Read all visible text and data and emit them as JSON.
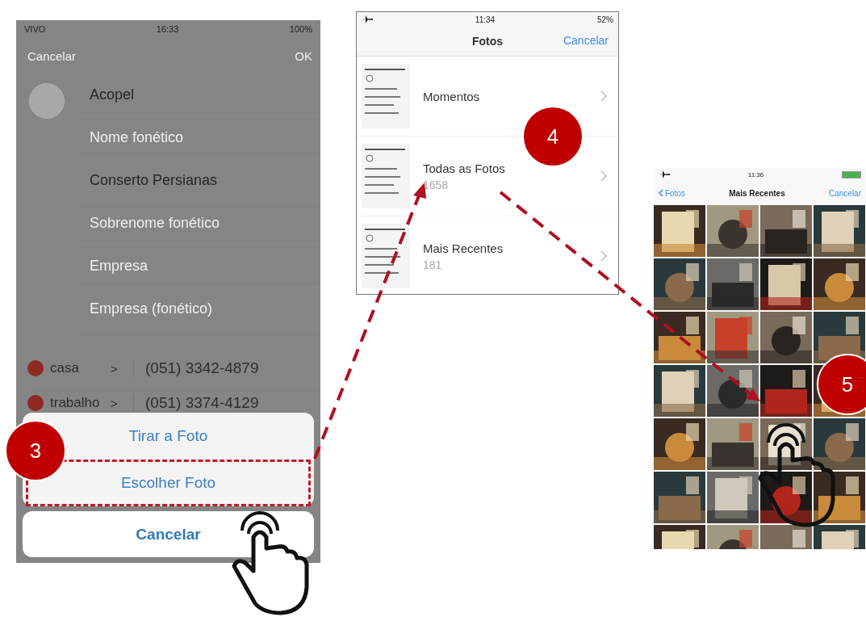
{
  "contact_screen": {
    "status_bar": {
      "carrier": "VIVO",
      "time": "16:33",
      "battery": "100%"
    },
    "nav": {
      "left": "Cancelar",
      "right": "OK"
    },
    "fields": [
      {
        "value": "Acopel"
      },
      {
        "placeholder": "Nome fonético"
      },
      {
        "value": "Conserto Persianas"
      },
      {
        "placeholder": "Sobrenome fonético"
      },
      {
        "placeholder": "Empresa"
      },
      {
        "placeholder": "Empresa (fonético)"
      }
    ],
    "phones": [
      {
        "label": "casa",
        "chevron": ">",
        "number": "(051) 3342-4879"
      },
      {
        "label": "trabalho",
        "chevron": ">",
        "number": "(051) 3374-4129"
      }
    ],
    "action_sheet": {
      "options": [
        {
          "label": "Tirar a Foto",
          "highlighted": false
        },
        {
          "label": "Escolher Foto",
          "highlighted": true
        }
      ],
      "cancel": "Cancelar"
    }
  },
  "albums_screen": {
    "status_bar": {
      "time": "11:34",
      "battery": "52%"
    },
    "nav": {
      "title": "Fotos",
      "right": "Cancelar"
    },
    "albums": [
      {
        "name": "Momentos"
      },
      {
        "name": "Todas as Fotos",
        "count": "1658"
      },
      {
        "name": "Mais Recentes",
        "count": "181"
      }
    ]
  },
  "photos_screen": {
    "status_bar": {
      "time": "11:36"
    },
    "nav": {
      "back": "Fotos",
      "title": "Mais Recentes",
      "right": "Cancelar"
    }
  },
  "step_badges": [
    {
      "label": "3"
    },
    {
      "label": "4"
    },
    {
      "label": "5"
    }
  ]
}
